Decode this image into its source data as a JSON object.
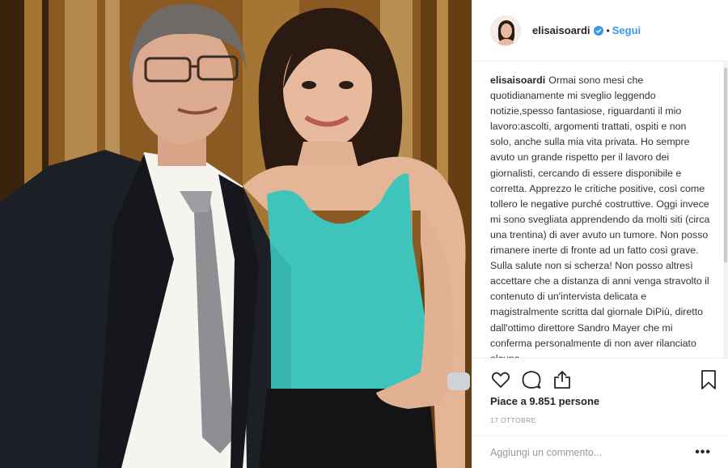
{
  "header": {
    "username": "elisaisoardi",
    "separator": "•",
    "follow_label": "Segui"
  },
  "caption": {
    "username": "elisaisoardi",
    "text": "Ormai sono mesi che quotidianamente mi sveglio leggendo notizie,spesso fantasiose, riguardanti il mio lavoro:ascolti, argomenti trattati, ospiti e non solo, anche sulla mia vita privata. Ho sempre avuto un grande rispetto per il lavoro dei giornalisti, cercando di essere disponibile e corretta. Apprezzo le critiche positive, così come tollero le negative purché costruttive. Oggi invece mi sono svegliata apprendendo da molti siti (circa una trentina) di aver avuto un tumore. Non posso rimanere inerte di fronte ad un fatto così grave. Sulla salute non si scherza! Non posso altresì accettare che a distanza di anni venga stravolto il contenuto di un'intervista delicata e magistralmente scritta dal giornale DiPiù, diretto dall'ottimo direttore Sandro Mayer che mi conferma personalmente di non aver rilanciato alcuna"
  },
  "likes": "Piace a 9.851 persone",
  "date": "17 OTTOBRE",
  "comment": {
    "placeholder": "Aggiungi un commento...",
    "more_label": "•••"
  },
  "icons": {
    "heart": "heart-icon",
    "comment": "comment-icon",
    "share": "share-icon",
    "save": "bookmark-icon",
    "verified": "verified-badge-icon"
  },
  "colors": {
    "link": "#3897f0",
    "text": "#262626",
    "muted": "#999999",
    "border": "#efefef"
  }
}
